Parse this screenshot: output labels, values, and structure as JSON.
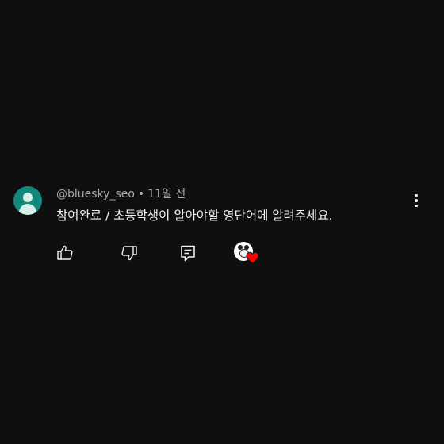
{
  "comment": {
    "author": "@bluesky_seo",
    "separator": "•",
    "time": "11일 전",
    "text": "참여완료 / 초등학생이 알아야할 영단어에 알려주세요."
  },
  "icons": {
    "avatar": "default-user-avatar-icon",
    "more": "more-vertical-icon",
    "like": "thumbs-up-icon",
    "dislike": "thumbs-down-icon",
    "reply": "comment-reply-icon",
    "creator_heart": "creator-heart-icon"
  },
  "colors": {
    "background": "#0f0f0f",
    "avatar": "#12897a",
    "heart": "#ff0000",
    "meta_text": "#aaaaaa",
    "text": "#f1f1f1"
  }
}
